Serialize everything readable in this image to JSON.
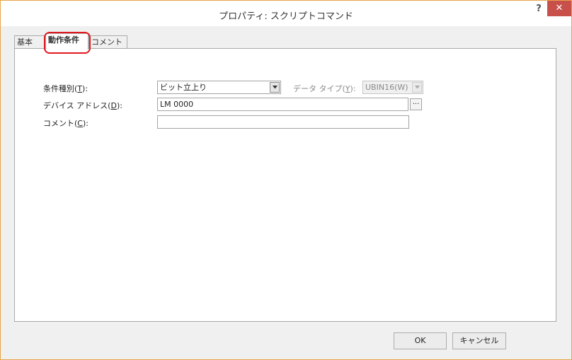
{
  "window": {
    "title": "プロパティ: スクリプトコマンド",
    "help_glyph": "?",
    "close_glyph": "✕"
  },
  "tabs": [
    {
      "label": "基本",
      "active": false
    },
    {
      "label": "動作条件",
      "active": true
    },
    {
      "label": "コメント",
      "active": false
    }
  ],
  "form": {
    "condition_type": {
      "label_pre": "条件種別(",
      "accel": "T",
      "label_post": "):",
      "value": "ビット立上り"
    },
    "data_type": {
      "label_pre": "データ タイプ(",
      "accel": "Y",
      "label_post": "):",
      "value": "UBIN16(W)",
      "enabled": false
    },
    "device_address": {
      "label_pre": "デバイス アドレス(",
      "accel": "D",
      "label_post": "):",
      "value": "LM 0000",
      "browse_label": "..."
    },
    "comment": {
      "label_pre": "コメント(",
      "accel": "C",
      "label_post": "):",
      "value": ""
    }
  },
  "buttons": {
    "ok": "OK",
    "cancel": "キャンセル"
  },
  "colors": {
    "close_button": "#c7504a",
    "tab_highlight": "#e0181f",
    "window_border": "#e8a54a"
  }
}
